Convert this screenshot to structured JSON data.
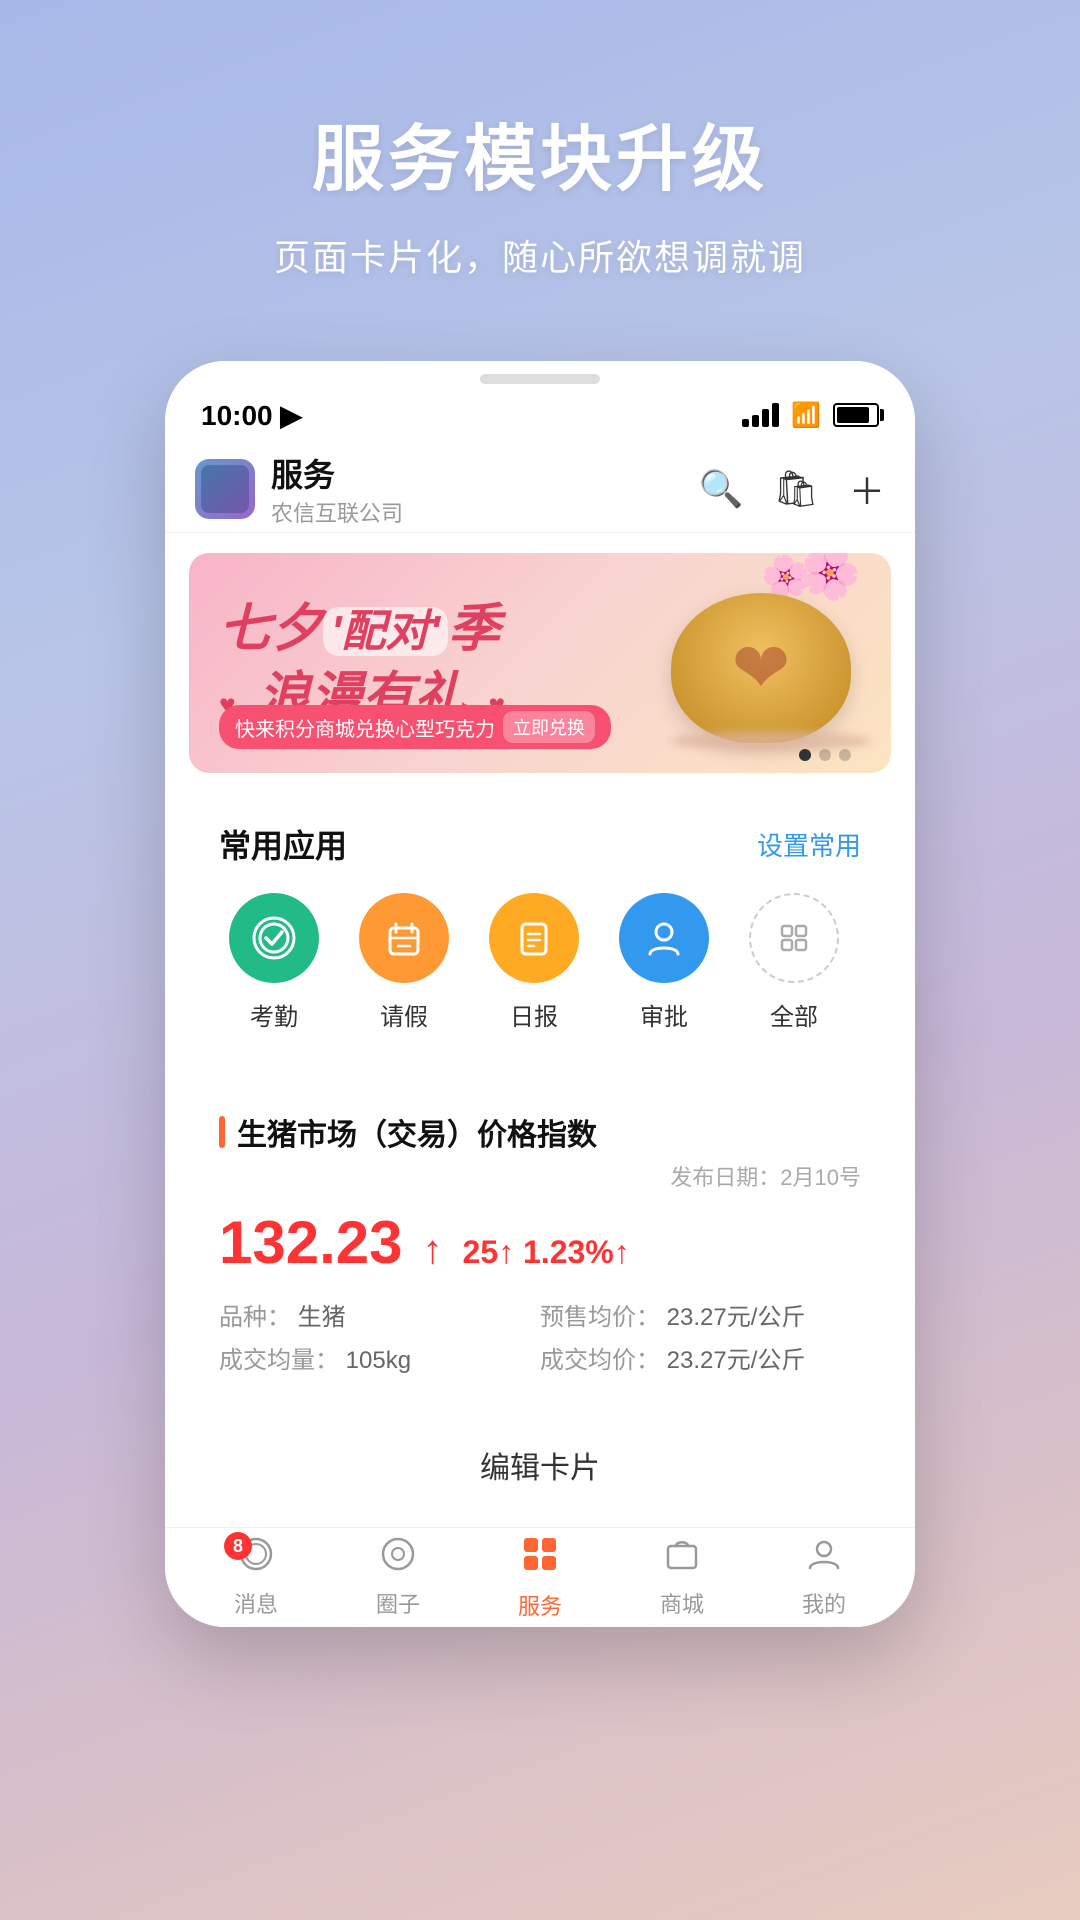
{
  "promo": {
    "title": "服务模块升级",
    "subtitle": "页面卡片化，随心所欲想调就调"
  },
  "status_bar": {
    "time": "10:00",
    "location_arrow": "▶"
  },
  "app_header": {
    "title": "服务",
    "subtitle": "农信互联公司",
    "search_label": "search",
    "bag_label": "bag",
    "add_label": "add"
  },
  "banner": {
    "line1": "七夕'配对'季",
    "line2": "浪漫有礼",
    "hearts_left": "♥",
    "hearts_right": "♥",
    "cta_text": "快来积分商城兑换心型巧克力",
    "cta_btn": "立即兑换",
    "dots": [
      true,
      false,
      false
    ]
  },
  "common_apps": {
    "section_title": "常用应用",
    "section_action": "设置常用",
    "apps": [
      {
        "name": "考勤",
        "icon": "✿",
        "color": "green"
      },
      {
        "name": "请假",
        "icon": "📅",
        "color": "orange"
      },
      {
        "name": "日报",
        "icon": "📋",
        "color": "yellow"
      },
      {
        "name": "审批",
        "icon": "👤",
        "color": "blue"
      },
      {
        "name": "全部",
        "icon": "⊞",
        "color": "outline"
      }
    ]
  },
  "market": {
    "title": "生猪市场（交易）价格指数",
    "date_label": "发布日期：",
    "date": "2月10号",
    "price": "132.23",
    "change_points": "25",
    "change_percent": "1.23%",
    "variety_label": "品种：",
    "variety": "生猪",
    "volume_label": "成交均量：",
    "volume": "105kg",
    "presale_label": "预售均价：",
    "presale": "23.27元/公斤",
    "trade_label": "成交均价：",
    "trade": "23.27元/公斤"
  },
  "edit_card": {
    "label": "编辑卡片"
  },
  "bottom_nav": {
    "items": [
      {
        "label": "消息",
        "icon": "💬",
        "active": false,
        "badge": "8"
      },
      {
        "label": "圈子",
        "icon": "◎",
        "active": false,
        "badge": ""
      },
      {
        "label": "服务",
        "icon": "⊞",
        "active": true,
        "badge": ""
      },
      {
        "label": "商城",
        "icon": "🏪",
        "active": false,
        "badge": ""
      },
      {
        "label": "我的",
        "icon": "👤",
        "active": false,
        "badge": ""
      }
    ]
  }
}
